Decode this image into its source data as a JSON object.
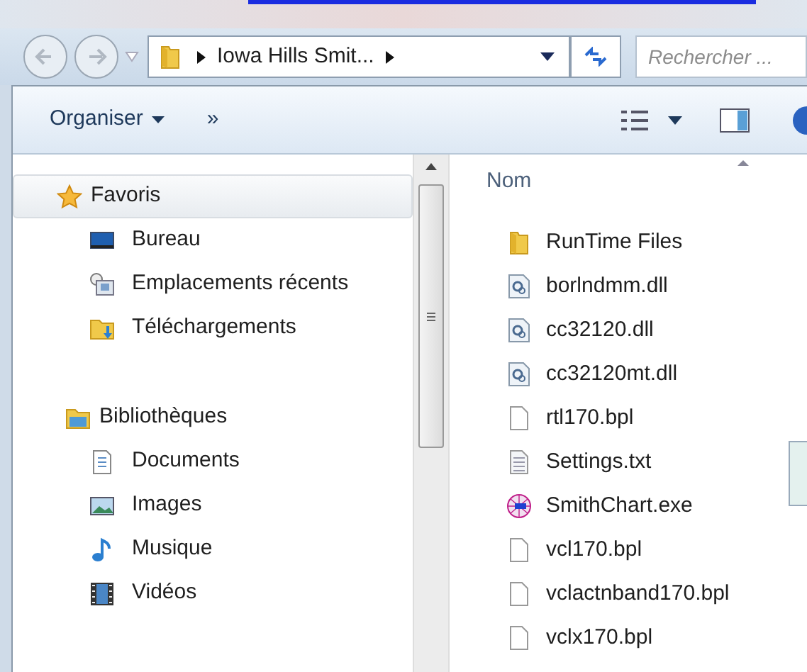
{
  "address_bar": {
    "path": "Iowa Hills Smit..."
  },
  "search": {
    "placeholder": "Rechercher ..."
  },
  "toolbar": {
    "organize": "Organiser",
    "more": "»"
  },
  "sidebar": {
    "groups": [
      {
        "label": "Favoris",
        "kind": "star",
        "selected": true,
        "children": [
          {
            "label": "Bureau",
            "kind": "desktop"
          },
          {
            "label": "Emplacements récents",
            "kind": "recent"
          },
          {
            "label": "Téléchargements",
            "kind": "download"
          }
        ]
      },
      {
        "label": "Bibliothèques",
        "kind": "library",
        "selected": false,
        "children": [
          {
            "label": "Documents",
            "kind": "document"
          },
          {
            "label": "Images",
            "kind": "image"
          },
          {
            "label": "Musique",
            "kind": "music"
          },
          {
            "label": "Vidéos",
            "kind": "video"
          }
        ]
      }
    ]
  },
  "file_list": {
    "column": "Nom",
    "files": [
      {
        "name": "RunTime Files",
        "kind": "folder"
      },
      {
        "name": "borlndmm.dll",
        "kind": "dll"
      },
      {
        "name": "cc32120.dll",
        "kind": "dll"
      },
      {
        "name": "cc32120mt.dll",
        "kind": "dll"
      },
      {
        "name": "rtl170.bpl",
        "kind": "file"
      },
      {
        "name": "Settings.txt",
        "kind": "text"
      },
      {
        "name": "SmithChart.exe",
        "kind": "exe"
      },
      {
        "name": "vcl170.bpl",
        "kind": "file"
      },
      {
        "name": "vclactnband170.bpl",
        "kind": "file"
      },
      {
        "name": "vclx170.bpl",
        "kind": "file"
      }
    ]
  }
}
